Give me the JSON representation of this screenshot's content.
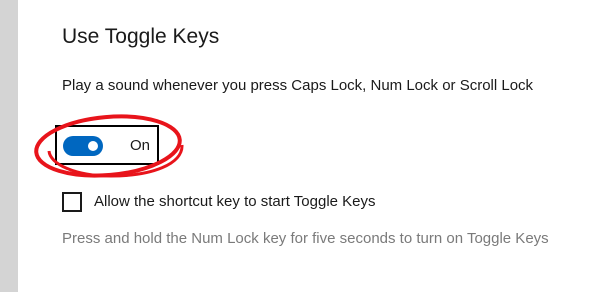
{
  "section": {
    "title": "Use Toggle Keys",
    "description": "Play a sound whenever you press Caps Lock, Num Lock or Scroll Lock"
  },
  "toggle": {
    "state_label": "On",
    "checked": true,
    "accent_color": "#0067c0"
  },
  "shortcut": {
    "checkbox_label": "Allow the shortcut key to start Toggle Keys",
    "checked": false,
    "help_text": "Press and hold the Num Lock key for five seconds to turn on Toggle Keys"
  },
  "annotation": {
    "color": "#e8141b",
    "shape": "ellipse"
  }
}
